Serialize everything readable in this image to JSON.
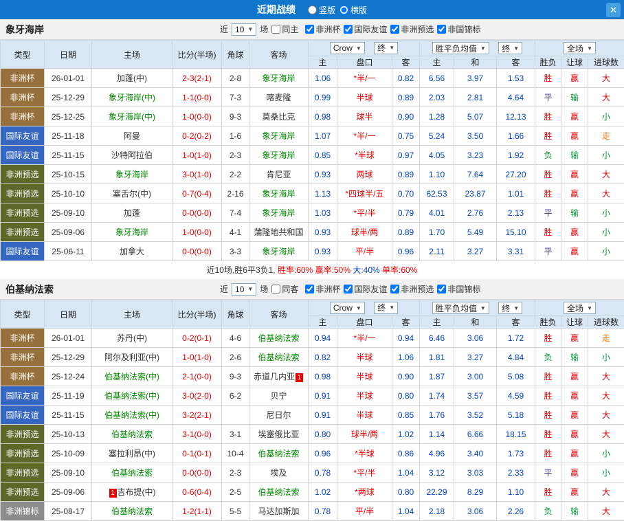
{
  "icons": {
    "close": "✕",
    "dropdown": "▼"
  },
  "top_bar": {
    "title": "近期战绩",
    "vertical_label": "竖版",
    "horizontal_label": "横版",
    "selected": "横版"
  },
  "table_header": {
    "type": "类型",
    "date": "日期",
    "home": "主场",
    "score": "比分(半场)",
    "corner": "角球",
    "away": "客场",
    "bookmaker": "Crow",
    "final": "终",
    "avg": "胜平负均值",
    "full": "全场",
    "sub": [
      "主",
      "盘口",
      "客",
      "主",
      "和",
      "客",
      "胜负",
      "让球",
      "进球数"
    ]
  },
  "type_styles": {
    "非洲杯": "#96713B",
    "国际友谊": "#3566C2",
    "非洲预选": "#5D672A",
    "非洲锦标": "#8C8C8C"
  },
  "result_colors": {
    "胜": "#E60000",
    "平": "#333399",
    "负": "#009933",
    "赢": "#E60000",
    "输": "#009933",
    "大": "#E60000",
    "小": "#009933",
    "走": "#FF7800"
  },
  "sections": [
    {
      "team": "象牙海岸",
      "filter": {
        "prefix": "近",
        "count": "10",
        "suffix": "场",
        "same_label": "同主",
        "same_checked": false,
        "comps": [
          {
            "label": "非洲杯",
            "checked": true
          },
          {
            "label": "国际友谊",
            "checked": true
          },
          {
            "label": "非洲预选",
            "checked": true
          },
          {
            "label": "非国锦标",
            "checked": true
          }
        ]
      },
      "rows": [
        {
          "type": "非洲杯",
          "date": "26-01-01",
          "home": {
            "name": "加蓬(中)"
          },
          "score": "2-3(2-1)",
          "corner": "2-8",
          "away": {
            "name": "象牙海岸",
            "focus": true
          },
          "odds": [
            "1.06",
            "*半/一",
            "0.82"
          ],
          "avg": [
            "6.56",
            "3.97",
            "1.53"
          ],
          "results": [
            "胜",
            "赢",
            "大"
          ]
        },
        {
          "type": "非洲杯",
          "date": "25-12-29",
          "home": {
            "name": "象牙海岸(中)",
            "focus": true
          },
          "score": "1-1(0-0)",
          "corner": "7-3",
          "away": {
            "name": "喀麦隆"
          },
          "odds": [
            "0.99",
            "半球",
            "0.89"
          ],
          "avg": [
            "2.03",
            "2.81",
            "4.64"
          ],
          "results": [
            "平",
            "输",
            "大"
          ]
        },
        {
          "type": "非洲杯",
          "date": "25-12-25",
          "home": {
            "name": "象牙海岸(中)",
            "focus": true
          },
          "score": "1-0(0-0)",
          "corner": "9-3",
          "away": {
            "name": "莫桑比克"
          },
          "odds": [
            "0.98",
            "球半",
            "0.90"
          ],
          "avg": [
            "1.28",
            "5.07",
            "12.13"
          ],
          "results": [
            "胜",
            "赢",
            "小"
          ]
        },
        {
          "type": "国际友谊",
          "date": "25-11-18",
          "home": {
            "name": "阿曼"
          },
          "score": "0-2(0-2)",
          "corner": "1-6",
          "away": {
            "name": "象牙海岸",
            "focus": true
          },
          "odds": [
            "1.07",
            "*半/一",
            "0.75"
          ],
          "avg": [
            "5.24",
            "3.50",
            "1.66"
          ],
          "results": [
            "胜",
            "赢",
            "走"
          ]
        },
        {
          "type": "国际友谊",
          "date": "25-11-15",
          "home": {
            "name": "沙特阿拉伯"
          },
          "score": "1-0(1-0)",
          "corner": "2-3",
          "away": {
            "name": "象牙海岸",
            "focus": true
          },
          "odds": [
            "0.85",
            "*半球",
            "0.97"
          ],
          "avg": [
            "4.05",
            "3.23",
            "1.92"
          ],
          "results": [
            "负",
            "输",
            "小"
          ]
        },
        {
          "type": "非洲预选",
          "date": "25-10-15",
          "home": {
            "name": "象牙海岸",
            "focus": true
          },
          "score": "3-0(1-0)",
          "corner": "2-2",
          "away": {
            "name": "肯尼亚"
          },
          "odds": [
            "0.93",
            "两球",
            "0.89"
          ],
          "avg": [
            "1.10",
            "7.64",
            "27.20"
          ],
          "results": [
            "胜",
            "赢",
            "大"
          ]
        },
        {
          "type": "非洲预选",
          "date": "25-10-10",
          "home": {
            "name": "塞舌尔(中)"
          },
          "score": "0-7(0-4)",
          "corner": "2-16",
          "away": {
            "name": "象牙海岸",
            "focus": true
          },
          "odds": [
            "1.13",
            "*四球半/五",
            "0.70"
          ],
          "avg": [
            "62.53",
            "23.87",
            "1.01"
          ],
          "results": [
            "胜",
            "赢",
            "大"
          ]
        },
        {
          "type": "非洲预选",
          "date": "25-09-10",
          "home": {
            "name": "加蓬"
          },
          "score": "0-0(0-0)",
          "corner": "7-4",
          "away": {
            "name": "象牙海岸",
            "focus": true
          },
          "odds": [
            "1.03",
            "*平/半",
            "0.79"
          ],
          "avg": [
            "4.01",
            "2.76",
            "2.13"
          ],
          "results": [
            "平",
            "输",
            "小"
          ]
        },
        {
          "type": "非洲预选",
          "date": "25-09-06",
          "home": {
            "name": "象牙海岸",
            "focus": true
          },
          "score": "1-0(0-0)",
          "corner": "4-1",
          "away": {
            "name": "蒲隆地共和国"
          },
          "odds": [
            "0.93",
            "球半/两",
            "0.89"
          ],
          "avg": [
            "1.70",
            "5.49",
            "15.10"
          ],
          "results": [
            "胜",
            "赢",
            "小"
          ]
        },
        {
          "type": "国际友谊",
          "date": "25-06-11",
          "home": {
            "name": "加拿大"
          },
          "score": "0-0(0-0)",
          "corner": "3-3",
          "away": {
            "name": "象牙海岸",
            "focus": true
          },
          "odds": [
            "0.93",
            "平/半",
            "0.96"
          ],
          "avg": [
            "2.11",
            "3.27",
            "3.31"
          ],
          "results": [
            "平",
            "赢",
            "小"
          ]
        }
      ],
      "summary": [
        {
          "text": "近10场,胜6平3负1, ",
          "color": "#333333"
        },
        {
          "text": "胜率:60% ",
          "color": "#E60000"
        },
        {
          "text": "赢率:50% ",
          "color": "#E60000"
        },
        {
          "text": "大:40% ",
          "color": "#0044CC"
        },
        {
          "text": "单率:60%",
          "color": "#E60000"
        }
      ]
    },
    {
      "team": "伯基纳法索",
      "filter": {
        "prefix": "近",
        "count": "10",
        "suffix": "场",
        "same_label": "同客",
        "same_checked": false,
        "comps": [
          {
            "label": "非洲杯",
            "checked": true
          },
          {
            "label": "国际友谊",
            "checked": true
          },
          {
            "label": "非洲预选",
            "checked": true
          },
          {
            "label": "非国锦标",
            "checked": true
          }
        ]
      },
      "rows": [
        {
          "type": "非洲杯",
          "date": "26-01-01",
          "home": {
            "name": "苏丹(中)"
          },
          "score": "0-2(0-1)",
          "corner": "4-6",
          "away": {
            "name": "伯基纳法索",
            "focus": true
          },
          "odds": [
            "0.94",
            "*半/一",
            "0.94"
          ],
          "avg": [
            "6.46",
            "3.06",
            "1.72"
          ],
          "results": [
            "胜",
            "赢",
            "走"
          ]
        },
        {
          "type": "非洲杯",
          "date": "25-12-29",
          "home": {
            "name": "阿尔及利亚(中)"
          },
          "score": "1-0(1-0)",
          "corner": "2-6",
          "away": {
            "name": "伯基纳法索",
            "focus": true
          },
          "odds": [
            "0.82",
            "半球",
            "1.06"
          ],
          "avg": [
            "1.81",
            "3.27",
            "4.84"
          ],
          "results": [
            "负",
            "输",
            "小"
          ]
        },
        {
          "type": "非洲杯",
          "date": "25-12-24",
          "home": {
            "name": "伯基纳法索(中)",
            "focus": true
          },
          "score": "2-1(0-0)",
          "corner": "9-3",
          "away": {
            "name": "赤道几内亚",
            "red_after": "1"
          },
          "odds": [
            "0.98",
            "半球",
            "0.90"
          ],
          "avg": [
            "1.87",
            "3.00",
            "5.08"
          ],
          "results": [
            "胜",
            "赢",
            "大"
          ]
        },
        {
          "type": "国际友谊",
          "date": "25-11-19",
          "home": {
            "name": "伯基纳法索(中)",
            "focus": true
          },
          "score": "3-0(2-0)",
          "corner": "6-2",
          "away": {
            "name": "贝宁"
          },
          "odds": [
            "0.91",
            "半球",
            "0.80"
          ],
          "avg": [
            "1.74",
            "3.57",
            "4.59"
          ],
          "results": [
            "胜",
            "赢",
            "大"
          ]
        },
        {
          "type": "国际友谊",
          "date": "25-11-15",
          "home": {
            "name": "伯基纳法索(中)",
            "focus": true
          },
          "score": "3-2(2-1)",
          "corner": "",
          "away": {
            "name": "尼日尔"
          },
          "odds": [
            "0.91",
            "半球",
            "0.85"
          ],
          "avg": [
            "1.76",
            "3.52",
            "5.18"
          ],
          "results": [
            "胜",
            "赢",
            "大"
          ]
        },
        {
          "type": "非洲预选",
          "date": "25-10-13",
          "home": {
            "name": "伯基纳法索",
            "focus": true
          },
          "score": "3-1(0-0)",
          "corner": "3-1",
          "away": {
            "name": "埃塞俄比亚"
          },
          "odds": [
            "0.80",
            "球半/两",
            "1.02"
          ],
          "avg": [
            "1.14",
            "6.66",
            "18.15"
          ],
          "results": [
            "胜",
            "赢",
            "大"
          ]
        },
        {
          "type": "非洲预选",
          "date": "25-10-09",
          "home": {
            "name": "塞拉利昂(中)"
          },
          "score": "0-1(0-1)",
          "corner": "10-4",
          "away": {
            "name": "伯基纳法索",
            "focus": true
          },
          "odds": [
            "0.96",
            "*半球",
            "0.86"
          ],
          "avg": [
            "4.96",
            "3.40",
            "1.73"
          ],
          "results": [
            "胜",
            "赢",
            "小"
          ]
        },
        {
          "type": "非洲预选",
          "date": "25-09-10",
          "home": {
            "name": "伯基纳法索",
            "focus": true
          },
          "score": "0-0(0-0)",
          "corner": "2-3",
          "away": {
            "name": "埃及"
          },
          "odds": [
            "0.78",
            "*平/半",
            "1.04"
          ],
          "avg": [
            "3.12",
            "3.03",
            "2.33"
          ],
          "results": [
            "平",
            "赢",
            "小"
          ]
        },
        {
          "type": "非洲预选",
          "date": "25-09-06",
          "home": {
            "name": "吉布提(中)",
            "red_before": "1"
          },
          "score": "0-6(0-4)",
          "corner": "2-5",
          "away": {
            "name": "伯基纳法索",
            "focus": true
          },
          "odds": [
            "1.02",
            "*两球",
            "0.80"
          ],
          "avg": [
            "22.29",
            "8.29",
            "1.10"
          ],
          "results": [
            "胜",
            "赢",
            "大"
          ]
        },
        {
          "type": "非洲锦标",
          "date": "25-08-17",
          "home": {
            "name": "伯基纳法索",
            "focus": true
          },
          "score": "1-2(1-1)",
          "corner": "5-5",
          "away": {
            "name": "马达加斯加"
          },
          "odds": [
            "0.78",
            "平/半",
            "1.04"
          ],
          "avg": [
            "2.18",
            "3.06",
            "2.26"
          ],
          "results": [
            "负",
            "输",
            "大"
          ]
        }
      ],
      "summary": null
    }
  ]
}
